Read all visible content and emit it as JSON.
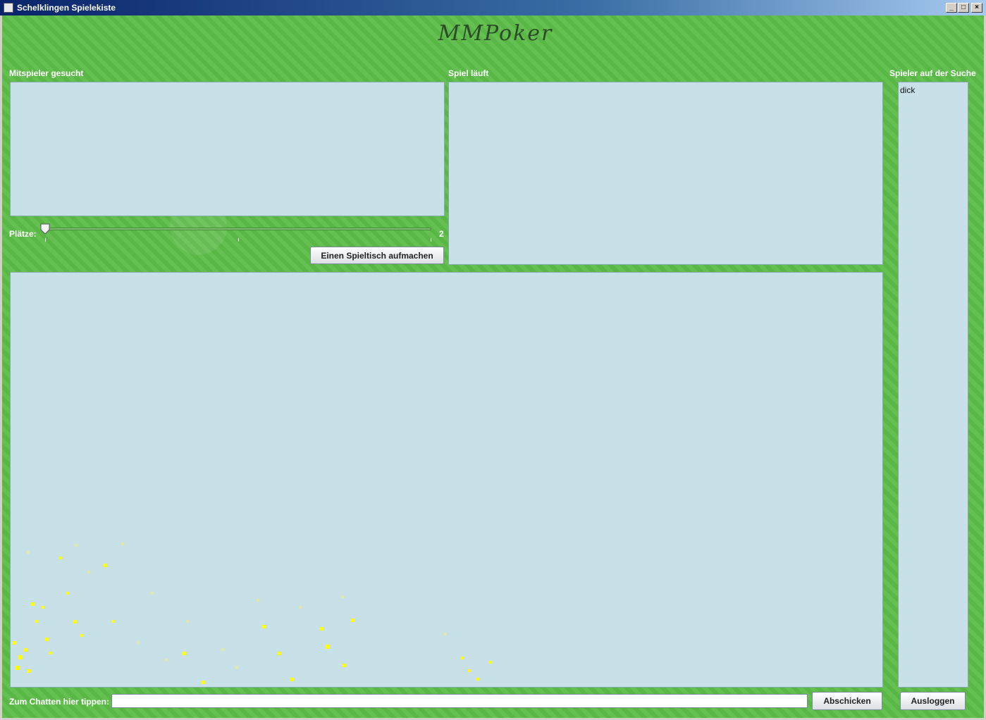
{
  "window": {
    "title": "Schelklingen Spielekiste",
    "minimize_symbol": "_",
    "maximize_symbol": "□",
    "close_symbol": "×"
  },
  "logo": {
    "text": "MMPoker"
  },
  "sections": {
    "looking_for_players": "Mitspieler gesucht",
    "game_running": "Spiel läuft",
    "players_searching": "Spieler auf der Suche"
  },
  "slider": {
    "label": "Plätze:",
    "value_text": "2"
  },
  "buttons": {
    "open_table": "Einen Spieltisch aufmachen",
    "send": "Abschicken",
    "logout": "Ausloggen"
  },
  "players_list": [
    "dick"
  ],
  "chat": {
    "label": "Zum Chatten hier tippen:",
    "value": ""
  },
  "colors": {
    "background": "#5cbd48",
    "panel": "#c8e1e8",
    "sparkle": "#ffff00"
  }
}
